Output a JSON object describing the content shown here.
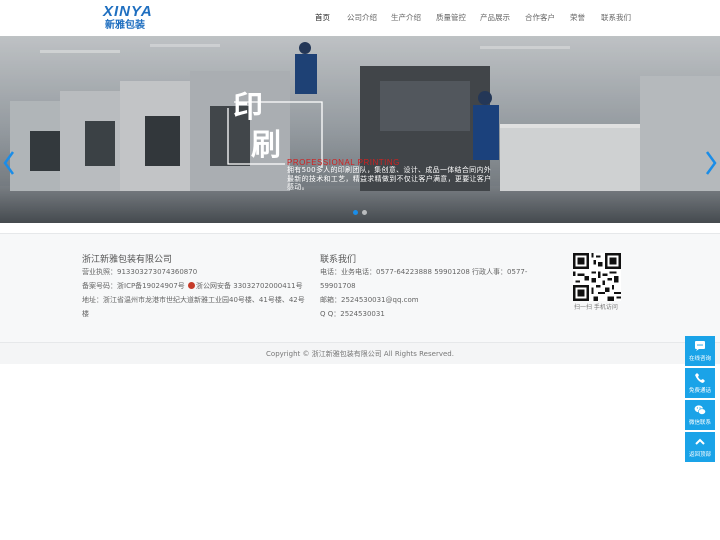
{
  "logo": {
    "brand": "XINYA",
    "cn": "新雅包装"
  },
  "nav": [
    {
      "label": "首页",
      "active": true
    },
    {
      "label": "公司介绍",
      "active": false
    },
    {
      "label": "生产介绍",
      "active": false
    },
    {
      "label": "质量管控",
      "active": false
    },
    {
      "label": "产品展示",
      "active": false
    },
    {
      "label": "合作客户",
      "active": false
    },
    {
      "label": "荣誉",
      "active": false
    },
    {
      "label": "联系我们",
      "active": false
    }
  ],
  "banner": {
    "title_char1": "印",
    "title_char2": "刷",
    "subtitle": "PROFESSIONAL PRINTING",
    "desc": "拥有500多人的印刷团队，集创意、设计、成品一体结合同内外最新的技术和工艺，精益求精做到不仅让客户满意，更要让客户感动。",
    "dot_count": 2,
    "active_dot": 1
  },
  "footer": {
    "company": {
      "title": "浙江新雅包装有限公司",
      "license": "营业执照：913303273074360870",
      "record_prefix": "备案号码：浙ICP备19024907号",
      "record_police": "浙公网安备 33032702000411号",
      "address_line1": "地址：浙江省温州市龙港市世纪大道新雅工业园40号楼、41号楼、42号",
      "address_line2": "楼"
    },
    "contact": {
      "title": "联系我们",
      "phone_line1": "电话：业务电话：0577-64223888 59901208 行政人事：0577-",
      "phone_line2": "59901708",
      "email": "邮箱：2524530031@qq.com",
      "qq": "Q  Q：2524530031"
    },
    "qr_caption": "扫一扫 手机访问",
    "copyright": "Copyright © 浙江新雅包装有限公司 All Rights Reserved."
  },
  "float_panel": [
    {
      "icon": "chat-icon",
      "label": "在线咨询"
    },
    {
      "icon": "phone-icon",
      "label": "免费通话"
    },
    {
      "icon": "wechat-icon",
      "label": "微信联系"
    },
    {
      "icon": "arrow-up-icon",
      "label": "返回顶部"
    }
  ],
  "colors": {
    "brand": "#1f6fc0",
    "accent": "#1aa3e8",
    "active_dot": "#1a8de8",
    "subtitle_red": "#d02020"
  }
}
